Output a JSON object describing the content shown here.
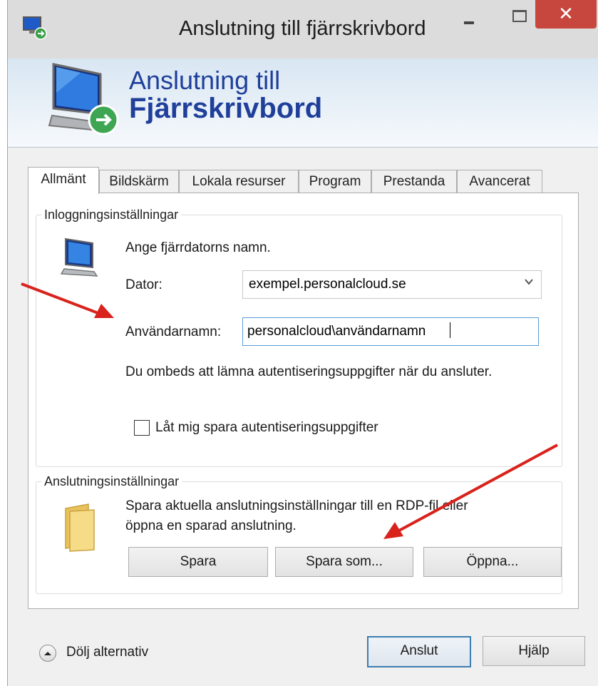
{
  "window": {
    "title": "Anslutning till fjärrskrivbord",
    "close_glyph": "✕"
  },
  "banner": {
    "line1": "Anslutning till",
    "line2": "Fjärrskrivbord"
  },
  "tabs": [
    {
      "label": "Allmänt",
      "active": true
    },
    {
      "label": "Bildskärm",
      "active": false
    },
    {
      "label": "Lokala resurser",
      "active": false
    },
    {
      "label": "Program",
      "active": false
    },
    {
      "label": "Prestanda",
      "active": false
    },
    {
      "label": "Avancerat",
      "active": false
    }
  ],
  "login_group": {
    "title": "Inloggningsinställningar",
    "description": "Ange fjärrdatorns namn.",
    "computer_label": "Dator:",
    "computer_value": "exempel.personalcloud.se",
    "username_label": "Användarnamn:",
    "username_value": "personalcloud\\användarnamn",
    "credentials_note": "Du ombeds att lämna autentiseringsuppgifter när du ansluter.",
    "save_credentials_label": "Låt mig spara autentiseringsuppgifter",
    "save_credentials_checked": false
  },
  "connection_group": {
    "title": "Anslutningsinställningar",
    "description_line1": "Spara aktuella anslutningsinställningar till en RDP-fil eller",
    "description_line2": "öppna en sparad anslutning.",
    "save_label": "Spara",
    "save_as_label": "Spara som...",
    "open_label": "Öppna..."
  },
  "footer": {
    "hide_options_label": "Dölj alternativ",
    "connect_label": "Anslut",
    "help_label": "Hjälp"
  },
  "colors": {
    "accent": "#1f3f9a",
    "close_button": "#c7463d",
    "annotation_arrow": "#d9221c",
    "focus_border": "#5a9ad6"
  },
  "icons": {
    "app": "remote-desktop-icon",
    "banner": "remote-desktop-monitor-icon",
    "computer": "computer-icon",
    "folder": "folder-icon",
    "combo": "chevron-down-icon",
    "expander": "chevron-up-icon"
  }
}
